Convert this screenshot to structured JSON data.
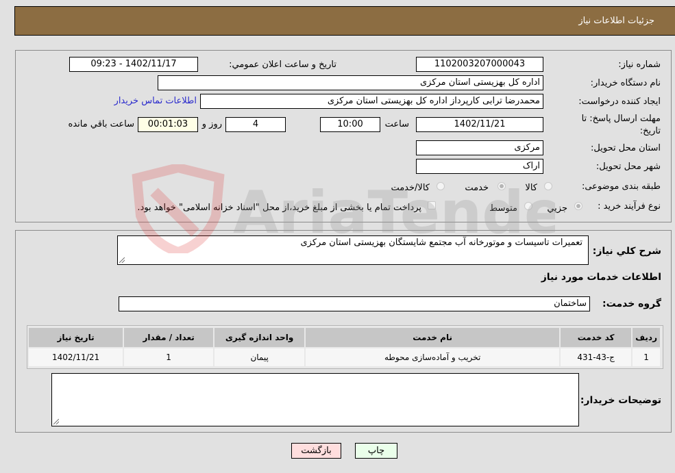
{
  "header": {
    "title": "جزئیات اطلاعات نیاز"
  },
  "details": {
    "need_number_label": "شماره نیاز:",
    "need_number": "1102003207000043",
    "announce_label": "تاریخ و ساعت اعلان عمومي:",
    "announce_value": "1402/11/17 - 09:23",
    "buyer_org_label": "نام دستگاه خریدار:",
    "buyer_org": "اداره کل بهزیستی استان مرکزی",
    "creator_label": "ایجاد کننده درخواست:",
    "creator": "محمدرضا ترابی کارپرداز اداره کل بهزیستی استان مرکزی",
    "contact_link": "اطلاعات تماس خریدار",
    "deadline_label_1": "مهلت ارسال پاسخ: تا",
    "deadline_label_2": "تاریخ:",
    "deadline_date": "1402/11/21",
    "time_label": "ساعت",
    "deadline_time": "10:00",
    "days_value": "4",
    "days_label": "روز و",
    "remaining_time": "00:01:03",
    "remaining_label": "ساعت باقي مانده",
    "province_label": "استان محل تحویل:",
    "province": "مرکزی",
    "city_label": "شهر محل تحویل:",
    "city": "اراک",
    "category_label": "طبقه بندی موضوعی:",
    "category_options": [
      "کالا",
      "خدمت",
      "کالا/خدمت"
    ],
    "category_selected": "خدمت",
    "process_label": "نوع فرآیند خرید :",
    "process_options": [
      "جزيي",
      "متوسط"
    ],
    "treasury_note": "پرداخت تمام یا بخشی از مبلغ خرید،از محل \"اسناد خزانه اسلامی\" خواهد بود."
  },
  "summary": {
    "description_label": "شرح كلي نياز:",
    "description": "تعمیرات تاسیسات و موتورخانه آب مجتمع شایستگان بهزیستی استان مرکزی",
    "services_heading": "اطلاعات خدمات مورد نیاز",
    "service_group_label": "گروه خدمت:",
    "service_group": "ساختمان"
  },
  "table": {
    "headers": [
      "ردیف",
      "کد خدمت",
      "نام خدمت",
      "واحد اندازه گیری",
      "تعداد / مقدار",
      "تاریخ نیاز"
    ],
    "rows": [
      [
        "1",
        "ج-43-431",
        "تخریب و آماده‌سازی محوطه",
        "پیمان",
        "1",
        "1402/11/21"
      ]
    ]
  },
  "buyer_notes": {
    "label": "توضیحات خریدار:",
    "value": ""
  },
  "buttons": {
    "print": "چاپ",
    "back": "بازگشت"
  },
  "watermark": {
    "text": "AriaTender.neT"
  },
  "colors": {
    "header_bg": "#8c6d42",
    "link": "#2a2acc",
    "print_bg": "#eaffea",
    "back_bg": "#ffdede"
  }
}
